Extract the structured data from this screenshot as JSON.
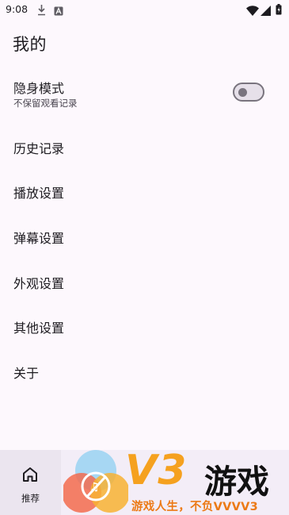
{
  "status_bar": {
    "time": "9:08"
  },
  "page": {
    "title": "我的"
  },
  "settings": {
    "incognito": {
      "label": "隐身模式",
      "description": "不保留观看记录",
      "enabled": false
    },
    "items": [
      {
        "label": "历史记录"
      },
      {
        "label": "播放设置"
      },
      {
        "label": "弹幕设置"
      },
      {
        "label": "外观设置"
      },
      {
        "label": "其他设置"
      },
      {
        "label": "关于"
      }
    ]
  },
  "bottom_nav": {
    "items": [
      {
        "label": "推荐",
        "icon": "home-icon",
        "selected": true
      }
    ]
  },
  "watermark": {
    "brand": "V3",
    "name": "游戏",
    "slogan": "游戏人生，不负VVVV3"
  },
  "colors": {
    "background": "#fdf8fd",
    "nav_background": "#f3edf7",
    "brand_orange": "#f5a11f"
  }
}
